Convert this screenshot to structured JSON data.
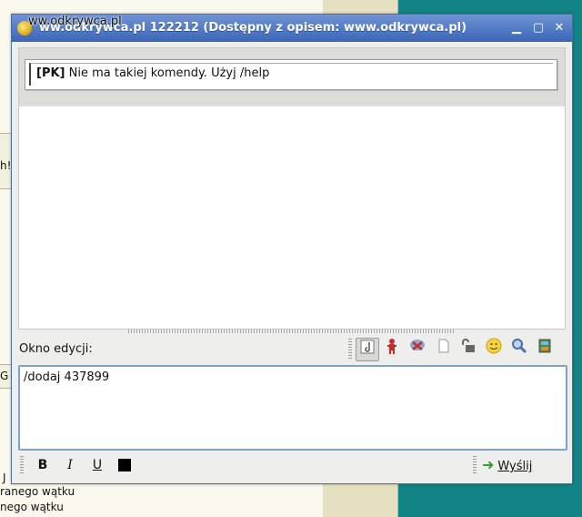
{
  "window": {
    "title": "ww.odkrywca.pl 122212 (Dostępny z opisem: www.odkrywca.pl)",
    "watermark": "ww.odkrywca.pl"
  },
  "chat": {
    "messages": [
      {
        "sender": "[PK]",
        "text": "Nie ma takiej komendy. Użyj /help"
      }
    ]
  },
  "editor": {
    "label": "Okno edycji:",
    "value": "/dodaj 437899"
  },
  "toolbar": {
    "icons": [
      "insert-image-icon",
      "person-icon",
      "block-icon",
      "paper-icon",
      "unlock-icon",
      "emoticon-icon",
      "search-icon",
      "history-icon"
    ]
  },
  "format": {
    "bold": "B",
    "italic": "I",
    "underline": "U",
    "color": "#000000"
  },
  "send": {
    "label": "Wyślij"
  },
  "background": {
    "fragments": [
      "h!",
      "G",
      "J",
      "ranego wątku",
      "nego wątku"
    ]
  }
}
